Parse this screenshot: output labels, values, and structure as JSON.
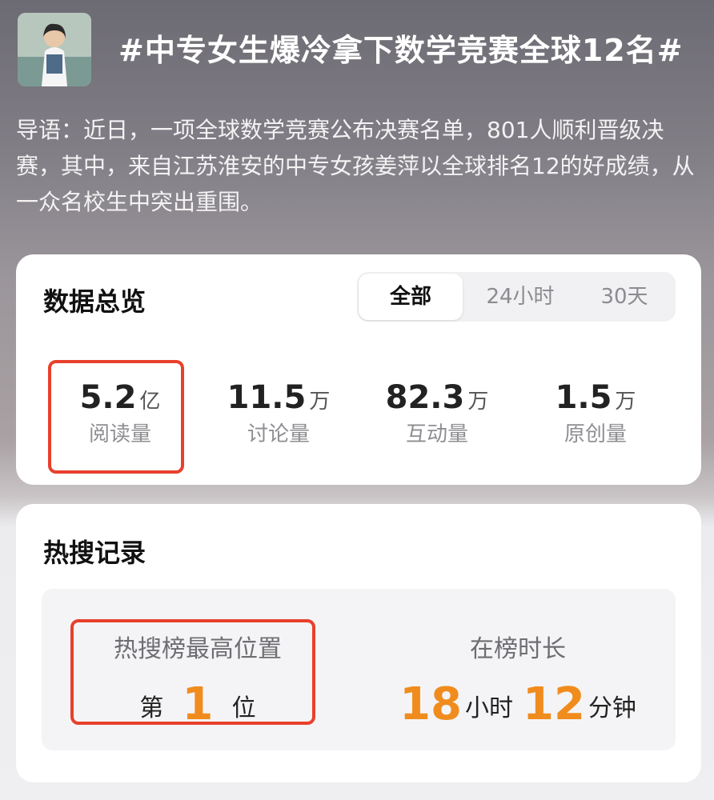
{
  "header": {
    "title": "#中专女生爆冷拿下数学竞赛全球12名#"
  },
  "intro": {
    "text": "导语：近日，一项全球数学竞赛公布决赛名单，801人顺利晋级决赛，其中，来自江苏淮安的中专女孩姜萍以全球排名12的好成绩，从一众名校生中突出重围。"
  },
  "overview": {
    "title": "数据总览",
    "tabs": [
      {
        "label": "全部",
        "active": true
      },
      {
        "label": "24小时",
        "active": false
      },
      {
        "label": "30天",
        "active": false
      }
    ],
    "stats": [
      {
        "value": "5.2",
        "unit": "亿",
        "label": "阅读量"
      },
      {
        "value": "11.5",
        "unit": "万",
        "label": "讨论量"
      },
      {
        "value": "82.3",
        "unit": "万",
        "label": "互动量"
      },
      {
        "value": "1.5",
        "unit": "万",
        "label": "原创量"
      }
    ]
  },
  "hot": {
    "title": "热搜记录",
    "rank": {
      "label": "热搜榜最高位置",
      "prefix": "第",
      "value": "1",
      "suffix": "位"
    },
    "duration": {
      "label": "在榜时长",
      "hours": "18",
      "hours_unit": "小时",
      "minutes": "12",
      "minutes_unit": "分钟"
    }
  },
  "colors": {
    "accent_orange": "#f08c1e",
    "highlight_red": "#e8402c"
  }
}
